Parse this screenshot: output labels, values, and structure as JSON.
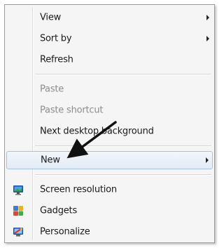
{
  "menu": {
    "items": [
      {
        "label": "View",
        "submenu": true
      },
      {
        "label": "Sort by",
        "submenu": true
      },
      {
        "label": "Refresh"
      },
      {
        "label": "Paste",
        "disabled": true
      },
      {
        "label": "Paste shortcut",
        "disabled": true
      },
      {
        "label": "Next desktop background"
      },
      {
        "label": "New",
        "submenu": true,
        "highlighted": true
      },
      {
        "label": "Screen resolution",
        "icon": "screen-resolution-icon"
      },
      {
        "label": "Gadgets",
        "icon": "gadgets-icon"
      },
      {
        "label": "Personalize",
        "icon": "personalize-icon"
      }
    ]
  },
  "colors": {
    "menu_background": "#f5f5f5",
    "highlight_border": "#a8c1e2",
    "disabled_text": "#8d8d8d",
    "annotation_arrow": "#111111"
  }
}
